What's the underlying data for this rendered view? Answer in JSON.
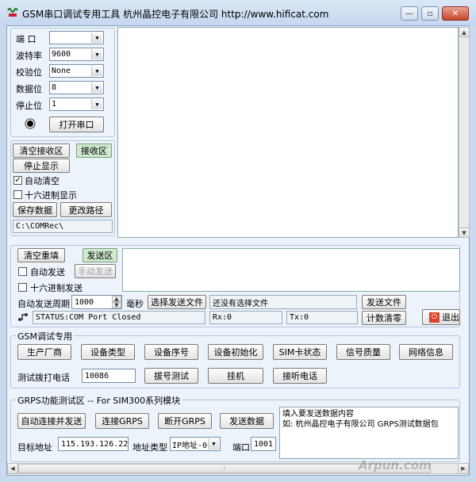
{
  "window": {
    "title": "GSM串口调试专用工具 杭州晶控电子有限公司   http://www.hificat.com",
    "min_label": "—",
    "max_label": "▫",
    "close_label": "✕"
  },
  "serial": {
    "port_label": "端  口",
    "port_value": "",
    "baud_label": "波特率",
    "baud_value": "9600",
    "parity_label": "校验位",
    "parity_value": "None",
    "databits_label": "数据位",
    "databits_value": "8",
    "stopbits_label": "停止位",
    "stopbits_value": "1",
    "open_button": "打开串口"
  },
  "receive": {
    "clear_button": "清空接收区",
    "area_label": "接收区",
    "stop_display_button": "停止显示",
    "auto_clear_label": "自动清空",
    "auto_clear_checked": true,
    "hex_display_label": "十六进制显示",
    "save_data_button": "保存数据",
    "change_path_button": "更改路径",
    "path": "C:\\COMRec\\"
  },
  "send": {
    "clear_button": "清空重填",
    "area_label": "发送区",
    "auto_send_label": "自动发送",
    "manual_send_button": "手动发送",
    "hex_send_label": "十六进制发送",
    "period_label": "自动发送周期",
    "period_value": "1000",
    "period_unit": "毫秒",
    "choose_file_button": "选择发送文件",
    "file_status": "还没有选择文件",
    "send_file_button": "发送文件",
    "status": "STATUS:COM Port Closed",
    "rx": "Rx:0",
    "tx": "Tx:0",
    "counter_clear_button": "计数清零",
    "exit_button": "退出"
  },
  "gsm": {
    "group_title": "GSM调试专用",
    "buttons": [
      "生产厂商",
      "设备类型",
      "设备序号",
      "设备初始化",
      "SIM卡状态",
      "信号质量",
      "网络信息"
    ],
    "dial_label": "测试拨打电话",
    "dial_number": "10086",
    "dial_test_button": "拔号测试",
    "hangup_button": "挂机",
    "answer_button": "接听电话"
  },
  "gprs": {
    "group_title": "GRPS功能测试区 -- For SIM300系列模块",
    "auto_connect_button": "自动连接并发送",
    "connect_button": "连接GRPS",
    "disconnect_button": "断开GRPS",
    "send_data_button": "发送数据",
    "data_text_line1": "填入要发送数据内容",
    "data_text_line2": "如: 杭州晶控电子有限公司  GRPS测试数据包",
    "target_label": "目标地址",
    "target_value": "115.193.126.228",
    "addr_type_label": "地址类型",
    "addr_type_value": "IP地址-0",
    "port_label": "端口",
    "port_value": "1001"
  },
  "watermark": "Arpun.com"
}
